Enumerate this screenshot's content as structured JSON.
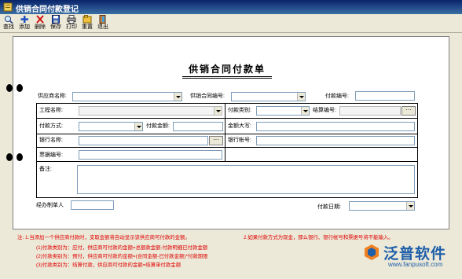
{
  "window": {
    "title": "供销合同付款登记"
  },
  "toolbar": {
    "items": [
      {
        "label": "查找",
        "icon": "search-icon"
      },
      {
        "label": "添加",
        "icon": "add-icon"
      },
      {
        "label": "删除",
        "icon": "delete-icon"
      },
      {
        "label": "保存",
        "icon": "save-icon"
      },
      {
        "label": "打印",
        "icon": "print-icon"
      },
      {
        "label": "重置",
        "icon": "reset-icon"
      },
      {
        "label": "退出",
        "icon": "exit-icon"
      }
    ]
  },
  "form": {
    "heading": "供销合同付款单",
    "supplier_label": "供应商名称:",
    "contract_no_label": "供销合同编号:",
    "payment_no_label": "付款编号:",
    "project_label": "工程名称:",
    "payment_category_label": "付款类别:",
    "settlement_no_label": "结算编号:",
    "payment_method_label": "付款方式:",
    "payment_amount_label": "付款金额:",
    "amount_upper_label": "金额大写:",
    "bank_name_label": "银行名称:",
    "bank_account_label": "银行帐号:",
    "bill_no_label": "票据编号:",
    "remarks_label": "备注:",
    "handler_label": "经办制单人",
    "payment_date_label": "付款日期:"
  },
  "notes": [
    "注: 1.当添加一个供应商付款时，支取金额将自动显示该供应商可付款的金额。",
    "2.如果付款方式为现金，那么银行、银行帐号和票据号将不能输入。",
    "(1)付款类别为：应付，供应商可付款的金额=总额款金额-付款明细已付款金额",
    "(2)付款类别为：预付，供应商可付款的金额=(合同金额-已付款金额)*付款期限",
    "(3)付款类别为：结算付款，供应商可付款的金额=结算单付款金额"
  ],
  "logo": {
    "brand": "泛普软件",
    "url": "www.fanpusoft.com"
  },
  "colors": {
    "title_bar": "#0a246a",
    "note_text": "#e00000",
    "brand": "#1f5fa9"
  }
}
